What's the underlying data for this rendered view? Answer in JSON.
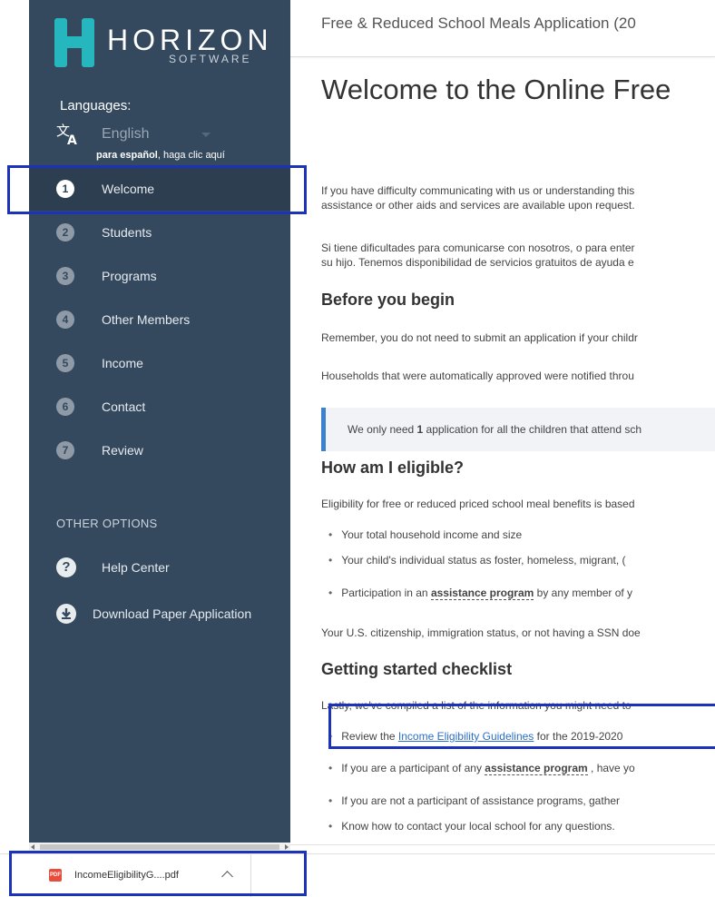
{
  "app": {
    "logo_word": "HORIZON",
    "logo_sub": "SOFTWARE",
    "brand_colors": {
      "sidebar": "#34495e",
      "logo_teal": "#25b7bd",
      "accent": "#3a82cf",
      "highlight": "#1a33b8"
    }
  },
  "sidebar": {
    "languages_label": "Languages:",
    "language_icon": "translate-icon",
    "language_selected": "English",
    "spanish_bold": "para español",
    "spanish_rest": ", haga clic aquí",
    "steps": [
      {
        "num": "1",
        "label": "Welcome",
        "active": true
      },
      {
        "num": "2",
        "label": "Students"
      },
      {
        "num": "3",
        "label": "Programs"
      },
      {
        "num": "4",
        "label": "Other Members"
      },
      {
        "num": "5",
        "label": "Income"
      },
      {
        "num": "6",
        "label": "Contact"
      },
      {
        "num": "7",
        "label": "Review"
      }
    ],
    "other_options_title": "OTHER OPTIONS",
    "help_center": "Help Center",
    "help_icon_glyph": "?",
    "download_paper": "Download Paper Application"
  },
  "header": {
    "title": "Free & Reduced School Meals Application (20"
  },
  "main": {
    "welcome_title": "Welcome to the Online Free",
    "intro_en_1": "If you have difficulty communicating with us or understanding this",
    "intro_en_2": "assistance or other aids and services are available upon request.",
    "intro_es_1": "Si tiene dificultades para comunicarse con nosotros, o para enter",
    "intro_es_2": "su hijo. Tenemos disponibilidad de servicios gratuitos de ayuda e",
    "before_title": "Before you begin",
    "before_p1": "Remember, you do not need to submit an application if your childr",
    "before_p2": "Households that were automatically approved were notified throu",
    "callout_before": "We only need ",
    "callout_bold": "1",
    "callout_after": " application for all the children that attend sch",
    "eligible_title": "How am I eligible?",
    "eligible_p": "Eligibility for free or reduced priced school meal benefits is based",
    "eligible_bullet_1": "Your total household income and size",
    "eligible_bullet_2": "Your child's individual status as foster, homeless, migrant, (",
    "eligible_bullet_3_pre": "Participation in an ",
    "eligible_bullet_3_term": "assistance program",
    "eligible_bullet_3_post": " by any member of y",
    "citizenship_p": "Your U.S. citizenship, immigration status, or not having a SSN doe",
    "checklist_title": "Getting started checklist",
    "checklist_p": "Lastly, we've compiled a list of the information you might need to",
    "checklist_1_pre": "Review the ",
    "checklist_1_link": "Income Eligibility Guidelines",
    "checklist_1_post": "  for the 2019-2020",
    "checklist_2_pre": "If you are a participant of any ",
    "checklist_2_term": "assistance program",
    "checklist_2_post": " , have yo",
    "checklist_3": "If you are not a participant of assistance programs, gather",
    "checklist_4": "Know how to contact your local school for any questions."
  },
  "download_bar": {
    "file_name": "IncomeEligibilityG....pdf",
    "file_icon_text": "PDF"
  }
}
